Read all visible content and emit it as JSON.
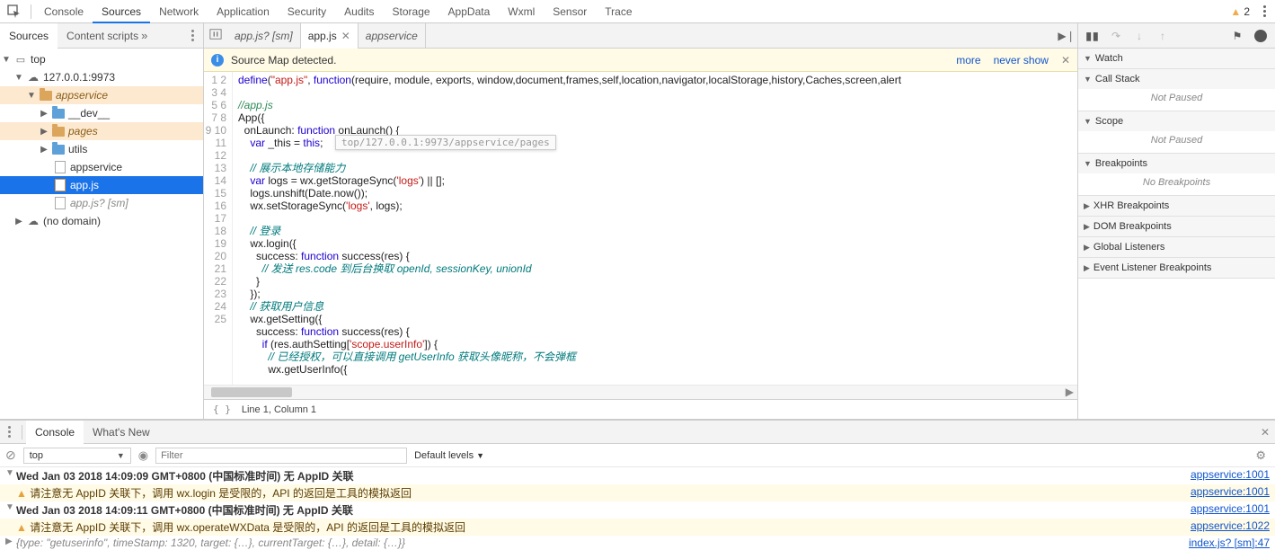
{
  "top_tabs": [
    "Console",
    "Sources",
    "Network",
    "Application",
    "Security",
    "Audits",
    "Storage",
    "AppData",
    "Wxml",
    "Sensor",
    "Trace"
  ],
  "top_active": "Sources",
  "warning_count": "2",
  "left": {
    "tabs": [
      "Sources",
      "Content scripts"
    ],
    "active": "Sources",
    "tree": {
      "top": "top",
      "domain": "127.0.0.1:9973",
      "appservice": "appservice",
      "dev": "__dev__",
      "pages": "pages",
      "utils": "utils",
      "appservice_file": "appservice",
      "appjs": "app.js",
      "appjs_sm": "app.js? [sm]",
      "no_domain": "(no domain)"
    }
  },
  "editor_tabs": [
    {
      "label": "app.js? [sm]",
      "italic": true,
      "close": false
    },
    {
      "label": "app.js",
      "italic": false,
      "close": true
    },
    {
      "label": "appservice",
      "italic": true,
      "close": false
    }
  ],
  "editor_active": 1,
  "infobar": {
    "text": "Source Map detected.",
    "more": "more",
    "never": "never show"
  },
  "tooltip": "top/127.0.0.1:9973/appservice/pages",
  "code_lines": [
    {
      "n": 1,
      "html": "<span class='tk-fn'>define</span>(<span class='tk-str'>\"app.js\"</span>, <span class='tk-kw'>function</span>(require, module, exports, window,document,frames,self,location,navigator,localStorage,history,Caches,screen,alert"
    },
    {
      "n": 2,
      "html": ""
    },
    {
      "n": 3,
      "html": "<span class='tk-com'>//app.js</span>"
    },
    {
      "n": 4,
      "html": "App({"
    },
    {
      "n": 5,
      "html": "  onLaunch: <span class='tk-kw'>function</span> onLaunch() {"
    },
    {
      "n": 6,
      "html": "    <span class='tk-kw'>var</span> _this = <span class='tk-kw'>this</span>;"
    },
    {
      "n": 7,
      "html": ""
    },
    {
      "n": 8,
      "html": "    <span class='tk-cn'>// 展示本地存储能力</span>"
    },
    {
      "n": 9,
      "html": "    <span class='tk-kw'>var</span> logs = wx.getStorageSync(<span class='tk-str'>'logs'</span>) || [];"
    },
    {
      "n": 10,
      "html": "    logs.unshift(Date.now());"
    },
    {
      "n": 11,
      "html": "    wx.setStorageSync(<span class='tk-str'>'logs'</span>, logs);"
    },
    {
      "n": 12,
      "html": ""
    },
    {
      "n": 13,
      "html": "    <span class='tk-cn'>// 登录</span>"
    },
    {
      "n": 14,
      "html": "    wx.login({"
    },
    {
      "n": 15,
      "html": "      success: <span class='tk-kw'>function</span> success(res) {"
    },
    {
      "n": 16,
      "html": "        <span class='tk-cn'>// 发送 res.code 到后台换取 openId, sessionKey, unionId</span>"
    },
    {
      "n": 17,
      "html": "      }"
    },
    {
      "n": 18,
      "html": "    });"
    },
    {
      "n": 19,
      "html": "    <span class='tk-cn'>// 获取用户信息</span>"
    },
    {
      "n": 20,
      "html": "    wx.getSetting({"
    },
    {
      "n": 21,
      "html": "      success: <span class='tk-kw'>function</span> success(res) {"
    },
    {
      "n": 22,
      "html": "        <span class='tk-kw'>if</span> (res.authSetting[<span class='tk-str'>'scope.userInfo'</span>]) {"
    },
    {
      "n": 23,
      "html": "          <span class='tk-cn'>// 已经授权，可以直接调用 getUserInfo 获取头像昵称，不会弹框</span>"
    },
    {
      "n": 24,
      "html": "          wx.getUserInfo({"
    },
    {
      "n": 25,
      "html": ""
    }
  ],
  "status": {
    "pos": "Line 1, Column 1"
  },
  "debugger": {
    "sections": [
      {
        "title": "Watch",
        "open": true,
        "body": ""
      },
      {
        "title": "Call Stack",
        "open": true,
        "body": "Not Paused"
      },
      {
        "title": "Scope",
        "open": true,
        "body": "Not Paused"
      },
      {
        "title": "Breakpoints",
        "open": true,
        "body": "No Breakpoints"
      },
      {
        "title": "XHR Breakpoints",
        "open": false
      },
      {
        "title": "DOM Breakpoints",
        "open": false
      },
      {
        "title": "Global Listeners",
        "open": false
      },
      {
        "title": "Event Listener Breakpoints",
        "open": false
      }
    ]
  },
  "console": {
    "tabs": [
      "Console",
      "What's New"
    ],
    "active": "Console",
    "context": "top",
    "filter_placeholder": "Filter",
    "levels": "Default levels",
    "lines": [
      {
        "type": "log",
        "expand": "down",
        "msg": "Wed Jan 03 2018 14:09:09 GMT+0800 (中国标准时间) 无 AppID 关联",
        "src": "appservice:1001",
        "bold": true
      },
      {
        "type": "warn",
        "expand": "",
        "msg": "请注意无 AppID 关联下，调用 wx.login 是受限的，API 的返回是工具的模拟返回",
        "src": "appservice:1001"
      },
      {
        "type": "log",
        "expand": "down",
        "msg": "Wed Jan 03 2018 14:09:11 GMT+0800 (中国标准时间) 无 AppID 关联",
        "src": "appservice:1001",
        "bold": true
      },
      {
        "type": "warn",
        "expand": "",
        "msg": "请注意无 AppID 关联下，调用 wx.operateWXData 是受限的，API 的返回是工具的模拟返回",
        "src": "appservice:1022"
      },
      {
        "type": "obj",
        "expand": "right",
        "msg": "{type: \"getuserinfo\", timeStamp: 1320, target: {…}, currentTarget: {…}, detail: {…}}",
        "src": "index.js? [sm]:47"
      }
    ]
  }
}
